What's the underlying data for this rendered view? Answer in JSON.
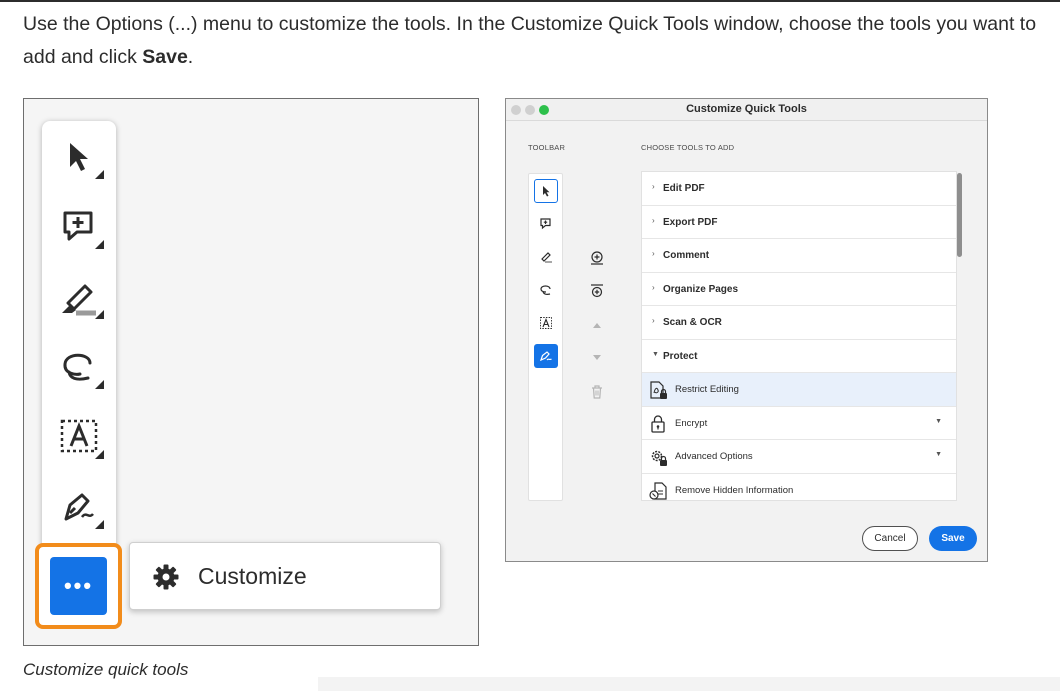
{
  "intro": {
    "text_before": "Use the Options (...) menu to customize the tools. In the Customize Quick Tools window, choose the tools you want to add and click ",
    "emphasis": "Save",
    "text_after": "."
  },
  "left_figure": {
    "toolbar_icons": [
      "select-arrow-icon",
      "add-comment-icon",
      "highlight-icon",
      "draw-lasso-icon",
      "text-box-icon",
      "fill-sign-icon"
    ],
    "more_button_label": "•••",
    "customize_label": "Customize",
    "highlight_color": "#f28c1b",
    "accent_color": "#1473e6"
  },
  "caption": "Customize quick tools",
  "dialog": {
    "title": "Customize Quick Tools",
    "toolbar_label": "TOOLBAR",
    "choose_label": "CHOOSE TOOLS TO ADD",
    "categories": [
      {
        "label": "Edit PDF",
        "expanded": false
      },
      {
        "label": "Export PDF",
        "expanded": false
      },
      {
        "label": "Comment",
        "expanded": false
      },
      {
        "label": "Organize Pages",
        "expanded": false
      },
      {
        "label": "Scan & OCR",
        "expanded": false
      },
      {
        "label": "Protect",
        "expanded": true
      }
    ],
    "subitems": [
      {
        "label": "Restrict Editing",
        "icon": "restrict-editing-icon",
        "has_dropdown": false,
        "selected": true
      },
      {
        "label": "Encrypt",
        "icon": "encrypt-lock-icon",
        "has_dropdown": true,
        "selected": false
      },
      {
        "label": "Advanced Options",
        "icon": "advanced-options-gear-icon",
        "has_dropdown": true,
        "selected": false
      },
      {
        "label": "Remove Hidden Information",
        "icon": "remove-hidden-info-icon",
        "has_dropdown": false,
        "selected": false
      }
    ],
    "cancel_label": "Cancel",
    "save_label": "Save",
    "traffic_colors": [
      "#d0d0d0",
      "#d0d0d0",
      "#2dc04b"
    ]
  }
}
